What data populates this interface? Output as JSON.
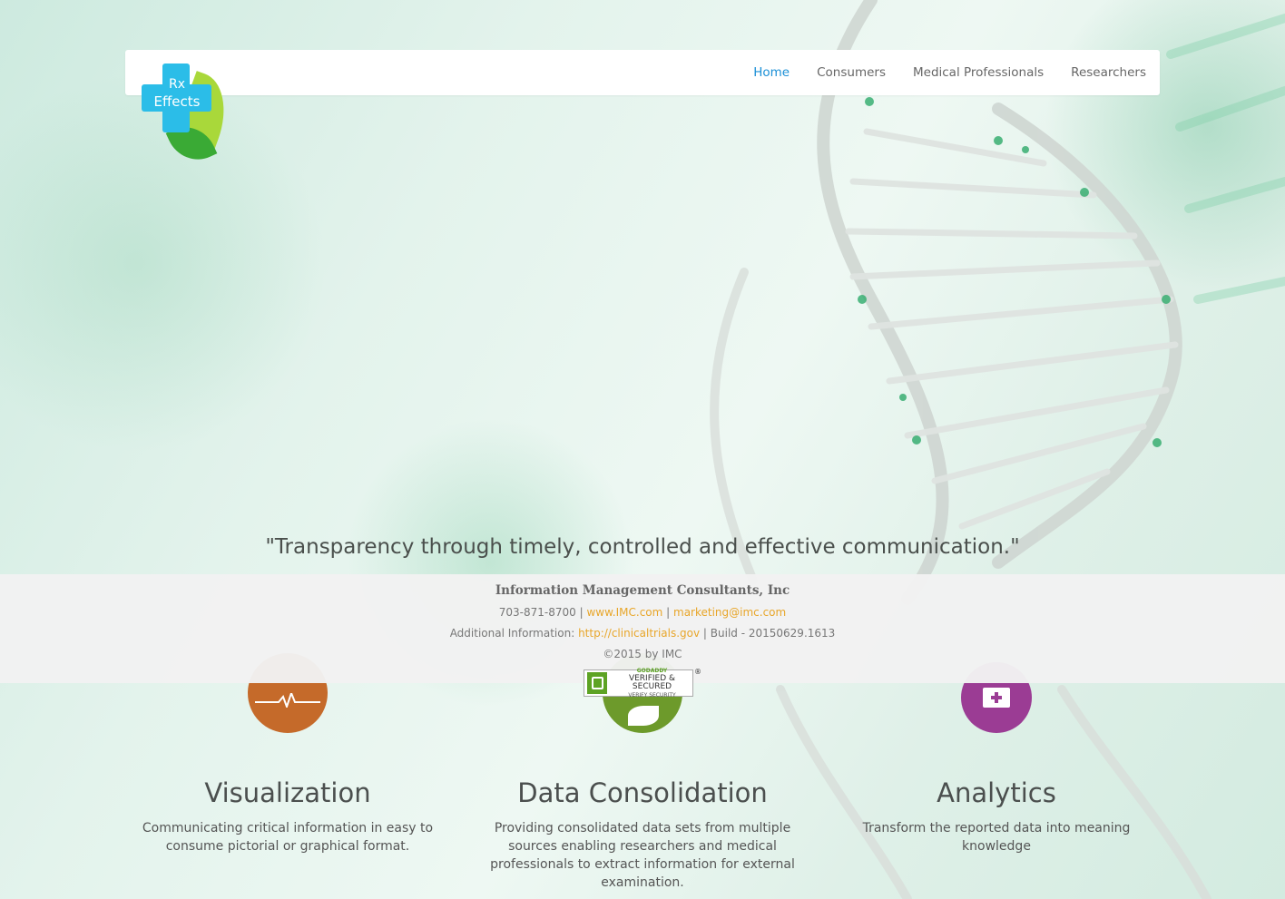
{
  "logo": {
    "line1": "Rx",
    "line2": "Effects"
  },
  "nav": {
    "items": [
      "Home",
      "Consumers",
      "Medical Professionals",
      "Researchers"
    ],
    "active": "Home"
  },
  "quote": "\"Transparency through timely, controlled and effective communication.\"",
  "footer": {
    "company": "Information Management Consultants, Inc",
    "phone": "703-871-8700",
    "sep": " | ",
    "website": "www.IMC.com",
    "email": "marketing@imc.com",
    "additional_label": "Additional Information: ",
    "additional_link": "http://clinicaltrials.gov",
    "build": " | Build - 20150629.1613",
    "copyright": "©2015 by IMC",
    "seal": {
      "line1": "GODADDY",
      "line2": "VERIFIED & SECURED",
      "line3": "VERIFY SECURITY",
      "mark": "®"
    }
  },
  "features": [
    {
      "title": "Visualization",
      "text": "Communicating critical information in easy to consume pictorial or graphical format.",
      "icon": "pulse-icon",
      "color": "#c56a2a"
    },
    {
      "title": "Data Consolidation",
      "text": "Providing consolidated data sets from multiple sources enabling researchers and medical professionals to extract information for external examination.",
      "icon": "leaf-icon",
      "color": "#6d9a2b"
    },
    {
      "title": "Analytics",
      "text": "Transform the reported data into meaning knowledge",
      "icon": "medical-kit-icon",
      "color": "#9b3c94"
    }
  ],
  "colors": {
    "accent": "#1a8fd6",
    "link": "#e8a62a",
    "brand_blue": "#2bbde8",
    "brand_green": "#3aaa35"
  }
}
